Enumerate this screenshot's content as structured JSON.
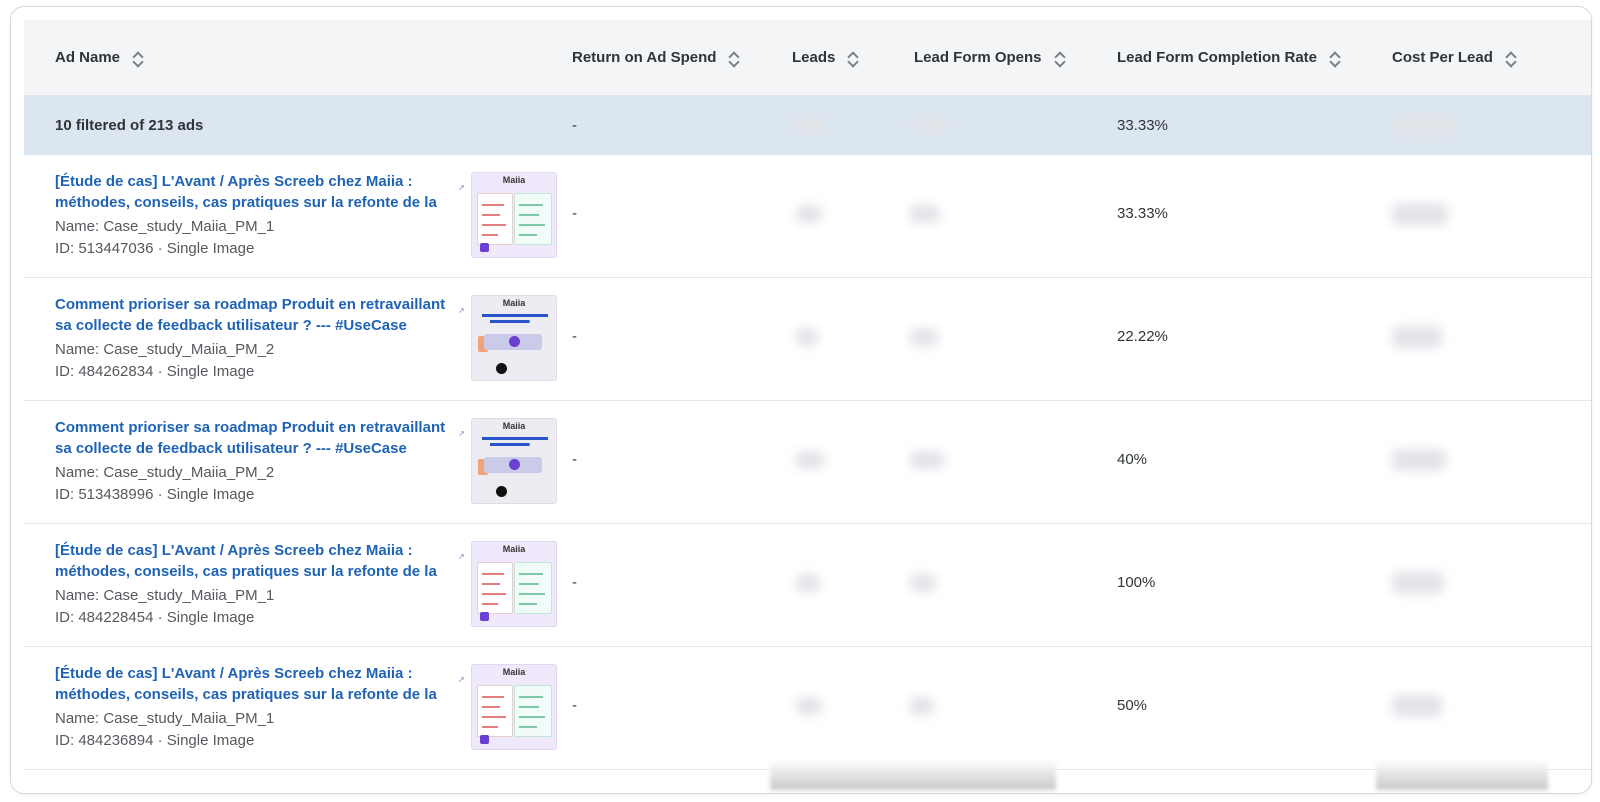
{
  "table": {
    "columns": [
      {
        "label": "Ad Name"
      },
      {
        "label": "Return on Ad Spend"
      },
      {
        "label": "Leads"
      },
      {
        "label": "Lead Form Opens"
      },
      {
        "label": "Lead Form Completion Rate"
      },
      {
        "label": "Cost Per Lead"
      }
    ],
    "summary": {
      "count_label": "10 filtered of 213 ads",
      "roas": "-",
      "completion_rate": "33.33%"
    },
    "rows": [
      {
        "title": "[Étude de cas] L'Avant / Après Screeb chez Maiia : méthodes, conseils, cas pratiques sur la refonte de la",
        "name": "Name: Case_study_Maiia_PM_1",
        "id_line": "ID: 513447036 · Single Image",
        "thumb_logo": "Maiia",
        "thumb_variant": "before-after",
        "roas": "-",
        "completion_rate": "33.33%"
      },
      {
        "title": "Comment prioriser sa roadmap Produit en retravaillant sa collecte de feedback utilisateur ? --- #UseCase",
        "name": "Name: Case_study_Maiia_PM_2",
        "id_line": "ID: 484262834 · Single Image",
        "thumb_logo": "Maiia",
        "thumb_variant": "roadmap",
        "roas": "-",
        "completion_rate": "22.22%"
      },
      {
        "title": "Comment prioriser sa roadmap Produit en retravaillant sa collecte de feedback utilisateur ? --- #UseCase",
        "name": "Name: Case_study_Maiia_PM_2",
        "id_line": "ID: 513438996 · Single Image",
        "thumb_logo": "Maiia",
        "thumb_variant": "roadmap",
        "roas": "-",
        "completion_rate": "40%"
      },
      {
        "title": "[Étude de cas] L'Avant / Après Screeb chez Maiia : méthodes, conseils, cas pratiques sur la refonte de la",
        "name": "Name: Case_study_Maiia_PM_1",
        "id_line": "ID: 484228454 · Single Image",
        "thumb_logo": "Maiia",
        "thumb_variant": "before-after",
        "roas": "-",
        "completion_rate": "100%"
      },
      {
        "title": "[Étude de cas] L'Avant / Après Screeb chez Maiia : méthodes, conseils, cas pratiques sur la refonte de la",
        "name": "Name: Case_study_Maiia_PM_1",
        "id_line": "ID: 484236894 · Single Image",
        "thumb_logo": "Maiia",
        "thumb_variant": "before-after",
        "roas": "-",
        "completion_rate": "50%"
      }
    ]
  },
  "icons": {
    "sort": "sort-icon",
    "external_link": "external-link-icon"
  },
  "colors": {
    "link": "#1f63b5",
    "summary_bg": "#dbe6f0",
    "header_bg": "#f4f5f7"
  }
}
